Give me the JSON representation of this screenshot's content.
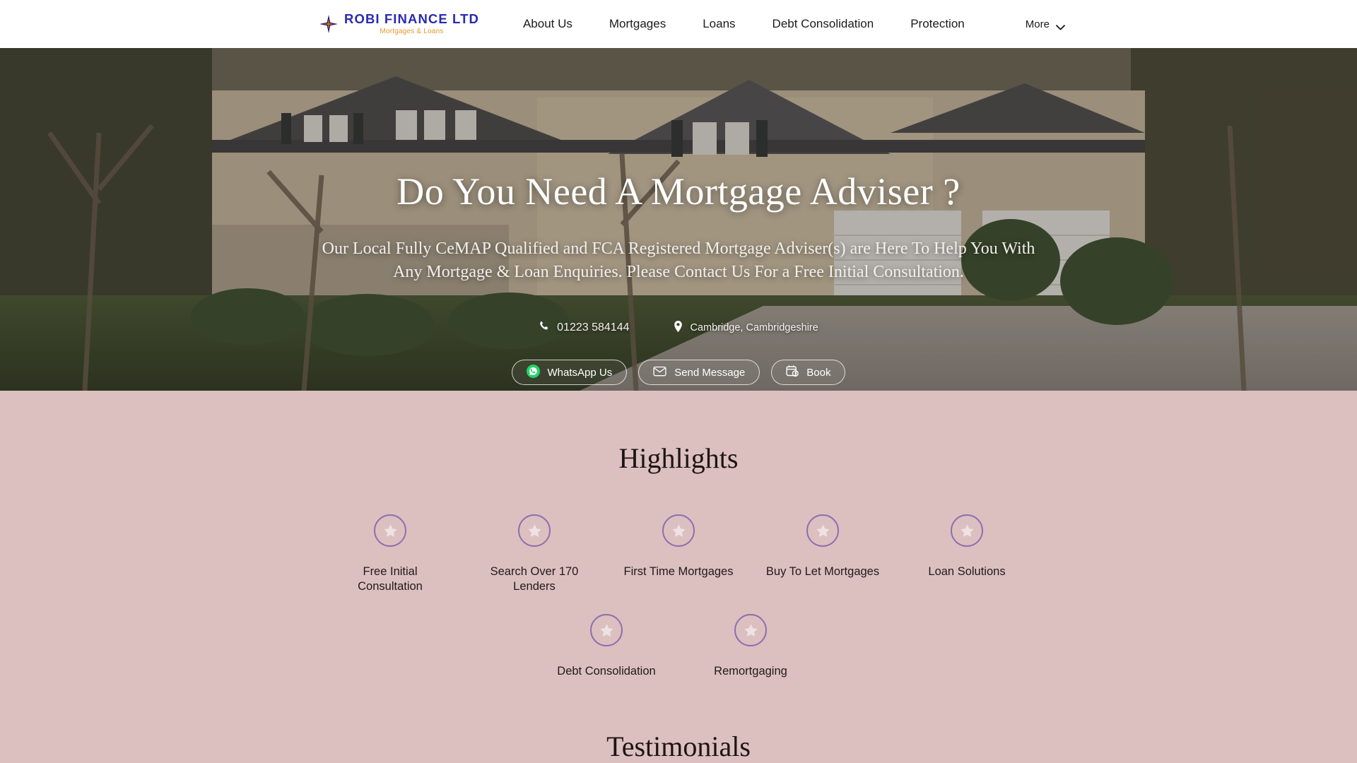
{
  "header": {
    "logo": {
      "icon": "four-point-star-icon",
      "name": "ROBI FINANCE LTD",
      "tagline": "Mortgages & Loans",
      "name_color": "#2a2ab0",
      "tagline_color": "#e8962e"
    },
    "nav": [
      {
        "label": "About Us"
      },
      {
        "label": "Mortgages"
      },
      {
        "label": "Loans"
      },
      {
        "label": "Debt Consolidation"
      },
      {
        "label": "Protection"
      }
    ],
    "more": {
      "label": "More",
      "icon": "chevron-down-icon"
    }
  },
  "hero": {
    "title": "Do You Need A Mortgage Adviser ?",
    "subtitle": "Our Local Fully CeMAP Qualified and FCA Registered Mortgage Adviser(s) are Here To Help You With Any Mortgage & Loan Enquiries. Please Contact Us For a Free Initial Consultation.",
    "phone": {
      "icon": "phone-icon",
      "label": "01223 584144"
    },
    "location": {
      "icon": "map-pin-icon",
      "label": "Cambridge, Cambridgeshire"
    },
    "buttons": [
      {
        "label": "WhatsApp Us",
        "icon": "whatsapp-icon",
        "accent": "#25D366"
      },
      {
        "label": "Send Message",
        "icon": "envelope-icon"
      },
      {
        "label": "Book",
        "icon": "calendar-clock-icon"
      }
    ]
  },
  "highlights": {
    "title": "Highlights",
    "icon": "star-icon",
    "accent": "#8c6fae",
    "row1": [
      {
        "label": "Free Initial Consultation"
      },
      {
        "label": "Search Over 170 Lenders"
      },
      {
        "label": "First Time Mortgages"
      },
      {
        "label": "Buy To Let Mortgages"
      },
      {
        "label": "Loan Solutions"
      }
    ],
    "row2": [
      {
        "label": "Debt Consolidation"
      },
      {
        "label": "Remortgaging"
      }
    ]
  },
  "testimonials": {
    "title": "Testimonials"
  },
  "theme": {
    "page_bg": "#dcc0c0",
    "header_bg": "#ffffff",
    "hero_text": "#ffffff"
  }
}
